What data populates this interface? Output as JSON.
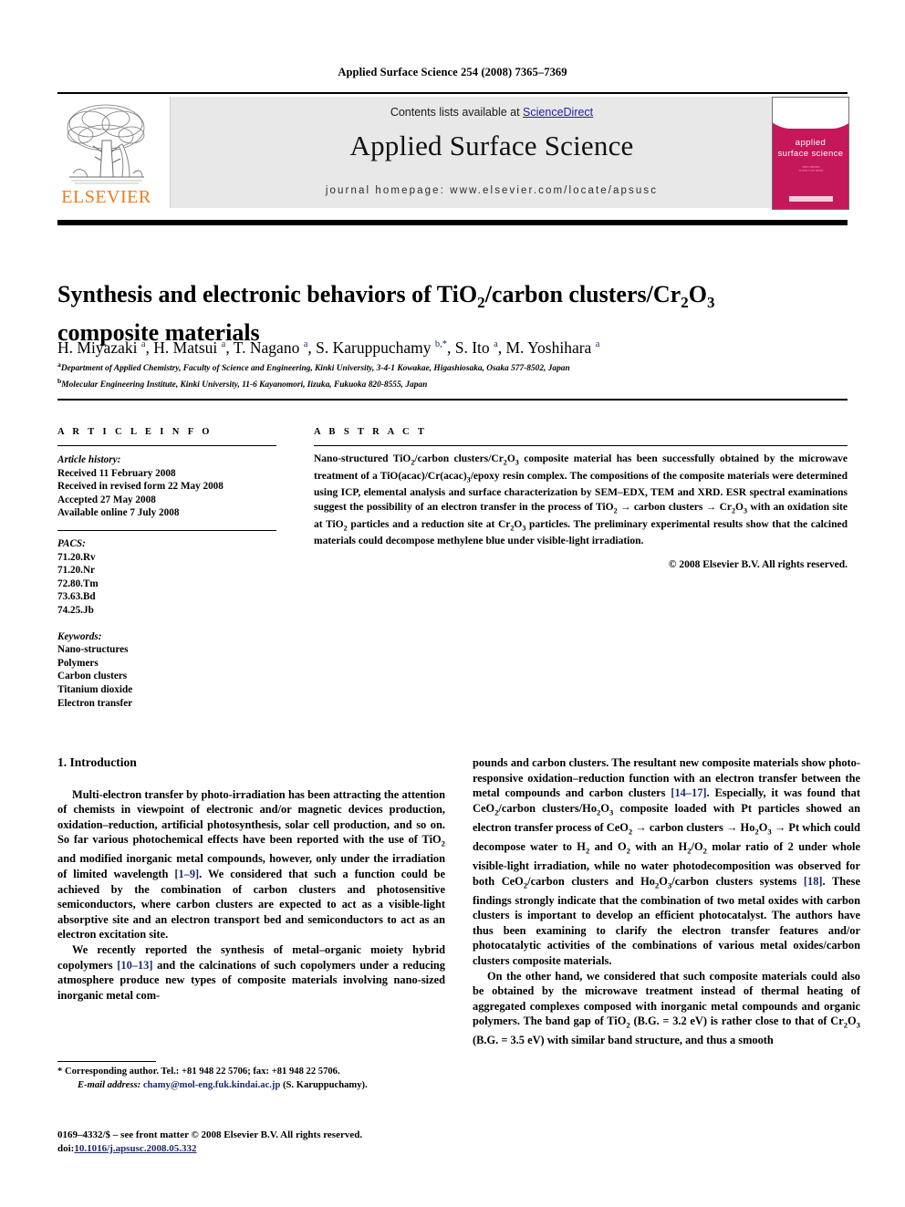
{
  "running_head": "Applied Surface Science 254 (2008) 7365–7369",
  "masthead": {
    "publisher": "ELSEVIER",
    "contents_prefix": "Contents lists available at ",
    "contents_link": "ScienceDirect",
    "journal_name": "Applied Surface Science",
    "homepage": "journal homepage: www.elsevier.com/locate/apsusc",
    "cover_title_line1": "applied",
    "cover_title_line2": "surface science",
    "cover_accent": "#c5185a",
    "link_color": "#2222aa",
    "publisher_color": "#ef7d1a"
  },
  "article": {
    "title_html": "Synthesis and electronic behaviors of TiO<sub>2</sub>/carbon clusters/Cr<sub>2</sub>O<sub>3</sub> composite materials",
    "title_plain": "Synthesis and electronic behaviors of TiO2/carbon clusters/Cr2O3 composite materials",
    "authors_html": "H. Miyazaki <sup>a</sup>, H. Matsui <sup>a</sup>, T. Nagano <sup>a</sup>, S. Karuppuchamy <sup>b,*</sup>, S. Ito <sup>a</sup>, M. Yoshihara <sup>a</sup>",
    "affiliations": [
      "Department of Applied Chemistry, Faculty of Science and Engineering, Kinki University, 3-4-1 Kowakae, Higashiosaka, Osaka 577-8502, Japan",
      "Molecular Engineering Institute, Kinki University, 11-6 Kayanomori, Iizuka, Fukuoka 820-8555, Japan"
    ],
    "affiliation_marks": [
      "a",
      "b"
    ]
  },
  "info": {
    "heading": "A R T I C L E  I N F O",
    "history_label": "Article history:",
    "history": [
      "Received 11 February 2008",
      "Received in revised form 22 May 2008",
      "Accepted 27 May 2008",
      "Available online 7 July 2008"
    ],
    "pacs_label": "PACS:",
    "pacs": [
      "71.20.Rv",
      "71.20.Nr",
      "72.80.Tm",
      "73.63.Bd",
      "74.25.Jb"
    ],
    "keywords_label": "Keywords:",
    "keywords": [
      "Nano-structures",
      "Polymers",
      "Carbon clusters",
      "Titanium dioxide",
      "Electron transfer"
    ]
  },
  "abstract": {
    "heading": "A B S T R A C T",
    "body_html": "Nano-structured TiO<sub>2</sub>/carbon clusters/Cr<sub>2</sub>O<sub>3</sub> composite material has been successfully obtained by the microwave treatment of a TiO(acac)/Cr(acac)<sub>3</sub>/epoxy resin complex. The compositions of the composite materials were determined using ICP, elemental analysis and surface characterization by SEM–EDX, TEM and XRD. ESR spectral examinations suggest the possibility of an electron transfer in the process of TiO<sub>2</sub> → carbon clusters → Cr<sub>2</sub>O<sub>3</sub> with an oxidation site at TiO<sub>2</sub> particles and a reduction site at Cr<sub>2</sub>O<sub>3</sub> particles. The preliminary experimental results show that the calcined materials could decompose methylene blue under visible-light irradiation.",
    "copyright": "© 2008 Elsevier B.V. All rights reserved."
  },
  "body": {
    "section_heading": "1. Introduction",
    "left_paragraphs_html": [
      "Multi-electron transfer by photo-irradiation has been attracting the attention of chemists in viewpoint of electronic and/or magnetic devices production, oxidation–reduction, artificial photosynthesis, solar cell production, and so on. So far various photochemical effects have been reported with the use of TiO<sub>2</sub> and modified inorganic metal compounds, however, only under the irradiation of limited wavelength <span class=\"ref\">[1–9]</span>. We considered that such a function could be achieved by the combination of carbon clusters and photosensitive semiconductors, where carbon clusters are expected to act as a visible-light absorptive site and an electron transport bed and semiconductors to act as an electron excitation site.",
      "We recently reported the synthesis of metal–organic moiety hybrid copolymers <span class=\"ref\">[10–13]</span> and the calcinations of such copolymers under a reducing atmosphere produce new types of composite materials involving nano-sized inorganic metal com-"
    ],
    "right_paragraphs_html": [
      "pounds and carbon clusters. The resultant new composite materials show photo-responsive oxidation–reduction function with an electron transfer between the metal compounds and carbon clusters <span class=\"ref\">[14–17]</span>. Especially, it was found that CeO<sub>2</sub>/carbon clusters/Ho<sub>2</sub>O<sub>3</sub> composite loaded with Pt particles showed an electron transfer process of CeO<sub>2</sub> → carbon clusters → Ho<sub>2</sub>O<sub>3</sub> → Pt which could decompose water to H<sub>2</sub> and O<sub>2</sub> with an H<sub>2</sub>/O<sub>2</sub> molar ratio of 2 under whole visible-light irradiation, while no water photodecomposition was observed for both CeO<sub>2</sub>/carbon clusters and Ho<sub>2</sub>O<sub>3</sub>/carbon clusters systems <span class=\"ref\">[18]</span>. These findings strongly indicate that the combination of two metal oxides with carbon clusters is important to develop an efficient photocatalyst. The authors have thus been examining to clarify the electron transfer features and/or photocatalytic activities of the combinations of various metal oxides/carbon clusters composite materials.",
      "On the other hand, we considered that such composite materials could also be obtained by the microwave treatment instead of thermal heating of aggregated complexes composed with inorganic metal compounds and organic polymers. The band gap of TiO<sub>2</sub> (B.G. = 3.2 eV) is rather close to that of Cr<sub>2</sub>O<sub>3</sub> (B.G. = 3.5 eV) with similar band structure, and thus a smooth"
    ]
  },
  "footnotes": {
    "corresponding_html": "<span class=\"ind\">* Corresponding author. Tel.: +81 948 22 5706; fax: +81 948 22 5706.</span><span class=\"ind2\"><span class=\"it\">E-mail address:</span> <span class=\"mail\">chamy@mol-eng.fuk.kindai.ac.jp</span> (S. Karuppuchamy).</span>",
    "imprint_line1": "0169–4332/$ – see front matter © 2008 Elsevier B.V. All rights reserved.",
    "doi_label": "doi:",
    "doi_value": "10.1016/j.apsusc.2008.05.332"
  }
}
